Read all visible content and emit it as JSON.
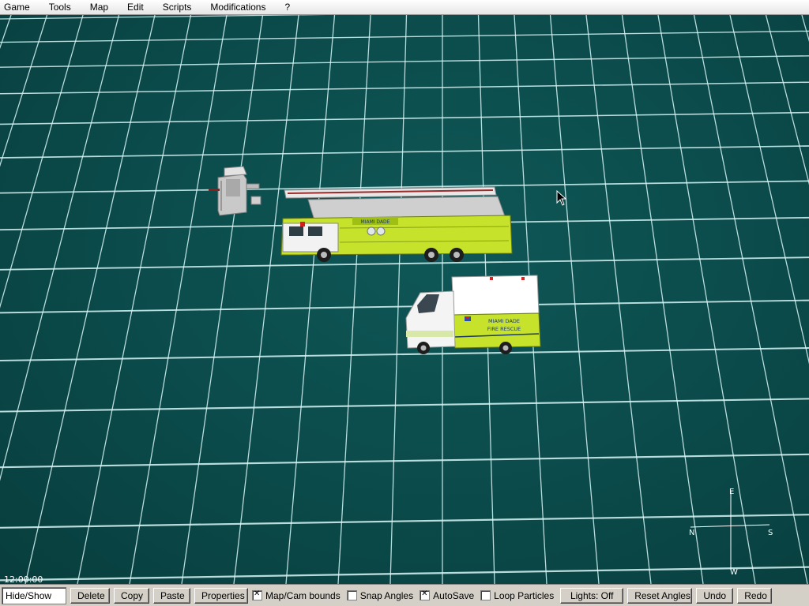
{
  "menu": {
    "items": [
      "Game",
      "Tools",
      "Map",
      "Edit",
      "Scripts",
      "Modifications",
      "?"
    ]
  },
  "viewport": {
    "clock": "12:00:00",
    "compass": {
      "north": "N",
      "south": "S",
      "east": "E",
      "west": "W"
    },
    "vehicles": {
      "ladder_truck_label": "MIAMI DADE",
      "ambulance_label_1": "MIAMI DADE",
      "ambulance_label_2": "FIRE RESCUE"
    }
  },
  "toolbar": {
    "hide_show": "Hide/Show",
    "delete": "Delete",
    "copy": "Copy",
    "paste": "Paste",
    "properties": "Properties",
    "map_cam_bounds": {
      "label": "Map/Cam bounds",
      "checked": true
    },
    "snap_angles": {
      "label": "Snap Angles",
      "checked": false
    },
    "autosave": {
      "label": "AutoSave",
      "checked": true
    },
    "loop_particles": {
      "label": "Loop Particles",
      "checked": false
    },
    "lights": "Lights: Off",
    "reset_angles": "Reset Angles",
    "undo": "Undo",
    "redo": "Redo"
  },
  "colors": {
    "background": "#0b4a4a",
    "grid_line": "#d8f6f6",
    "vehicle_green": "#c6e22a"
  }
}
